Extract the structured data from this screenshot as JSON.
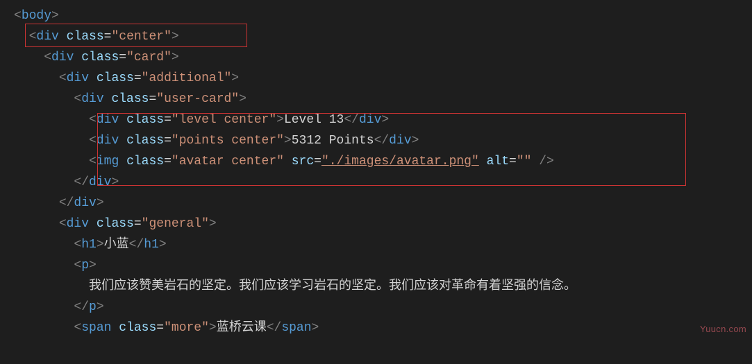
{
  "code": {
    "l1": {
      "tag": "body"
    },
    "l2": {
      "tag": "div",
      "attr": "class",
      "val": "\"center\""
    },
    "l3": {
      "tag": "div",
      "attr": "class",
      "val": "\"card\""
    },
    "l4": {
      "tag": "div",
      "attr": "class",
      "val": "\"additional\""
    },
    "l5": {
      "tag": "div",
      "attr": "class",
      "val": "\"user-card\""
    },
    "l6": {
      "tag": "div",
      "attr": "class",
      "val": "\"level center\"",
      "text": "Level 13",
      "close": "div"
    },
    "l7": {
      "tag": "div",
      "attr": "class",
      "val": "\"points center\"",
      "text": "5312 Points",
      "close": "div"
    },
    "l8": {
      "tag": "img",
      "attr1": "class",
      "val1": "\"avatar center\"",
      "attr2": "src",
      "val2": "\"./images/avatar.png\"",
      "attr3": "alt",
      "val3": "\"\""
    },
    "l9": {
      "close": "div"
    },
    "l10": {
      "close": "div"
    },
    "l11": {
      "tag": "div",
      "attr": "class",
      "val": "\"general\""
    },
    "l12": {
      "tag": "h1",
      "text": "小蓝",
      "close": "h1"
    },
    "l13": {
      "tag": "p"
    },
    "l14": {
      "text": "我们应该赞美岩石的坚定。我们应该学习岩石的坚定。我们应该对革命有着坚强的信念。"
    },
    "l15": {
      "close": "p"
    },
    "l16": {
      "tag": "span",
      "attr": "class",
      "val": "\"more\"",
      "text": "蓝桥云课",
      "close": "span"
    }
  },
  "watermark": "Yuucn.com"
}
